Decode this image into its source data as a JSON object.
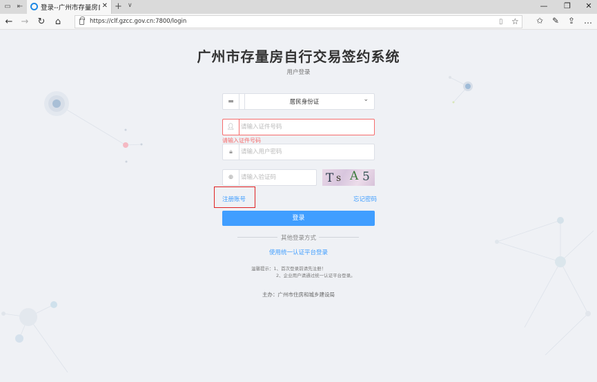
{
  "browser": {
    "tab_title": "登录--广州市存量房自行",
    "url": "https://clf.gzcc.gov.cn:7800/login"
  },
  "page": {
    "title": "广州市存量房自行交易签约系统",
    "subtitle": "用户登录"
  },
  "form": {
    "id_type_value": "居民身份证",
    "id_number_placeholder": "请输入证件号码",
    "id_number_error": "请输入证件号码",
    "password_placeholder": "请输入用户密码",
    "captcha_placeholder": "请输入验证码",
    "captcha_chars": [
      "T",
      "s",
      "A",
      "5"
    ],
    "register_label": "注册账号",
    "forgot_label": "忘记密码",
    "login_label": "登录"
  },
  "other": {
    "divider_label": "其他登录方式",
    "unified_login_label": "使用统一认证平台登录"
  },
  "tips": {
    "label": "温馨提示：",
    "line1": "1、首次登录前请先注册！",
    "line2": "2、企业用户请通过统一认证平台登录。"
  },
  "footer": {
    "sponsor": "主办：广州市住房和城乡建设局"
  },
  "colors": {
    "accent": "#409eff",
    "error": "#f56c6c",
    "highlight": "#e02020"
  }
}
